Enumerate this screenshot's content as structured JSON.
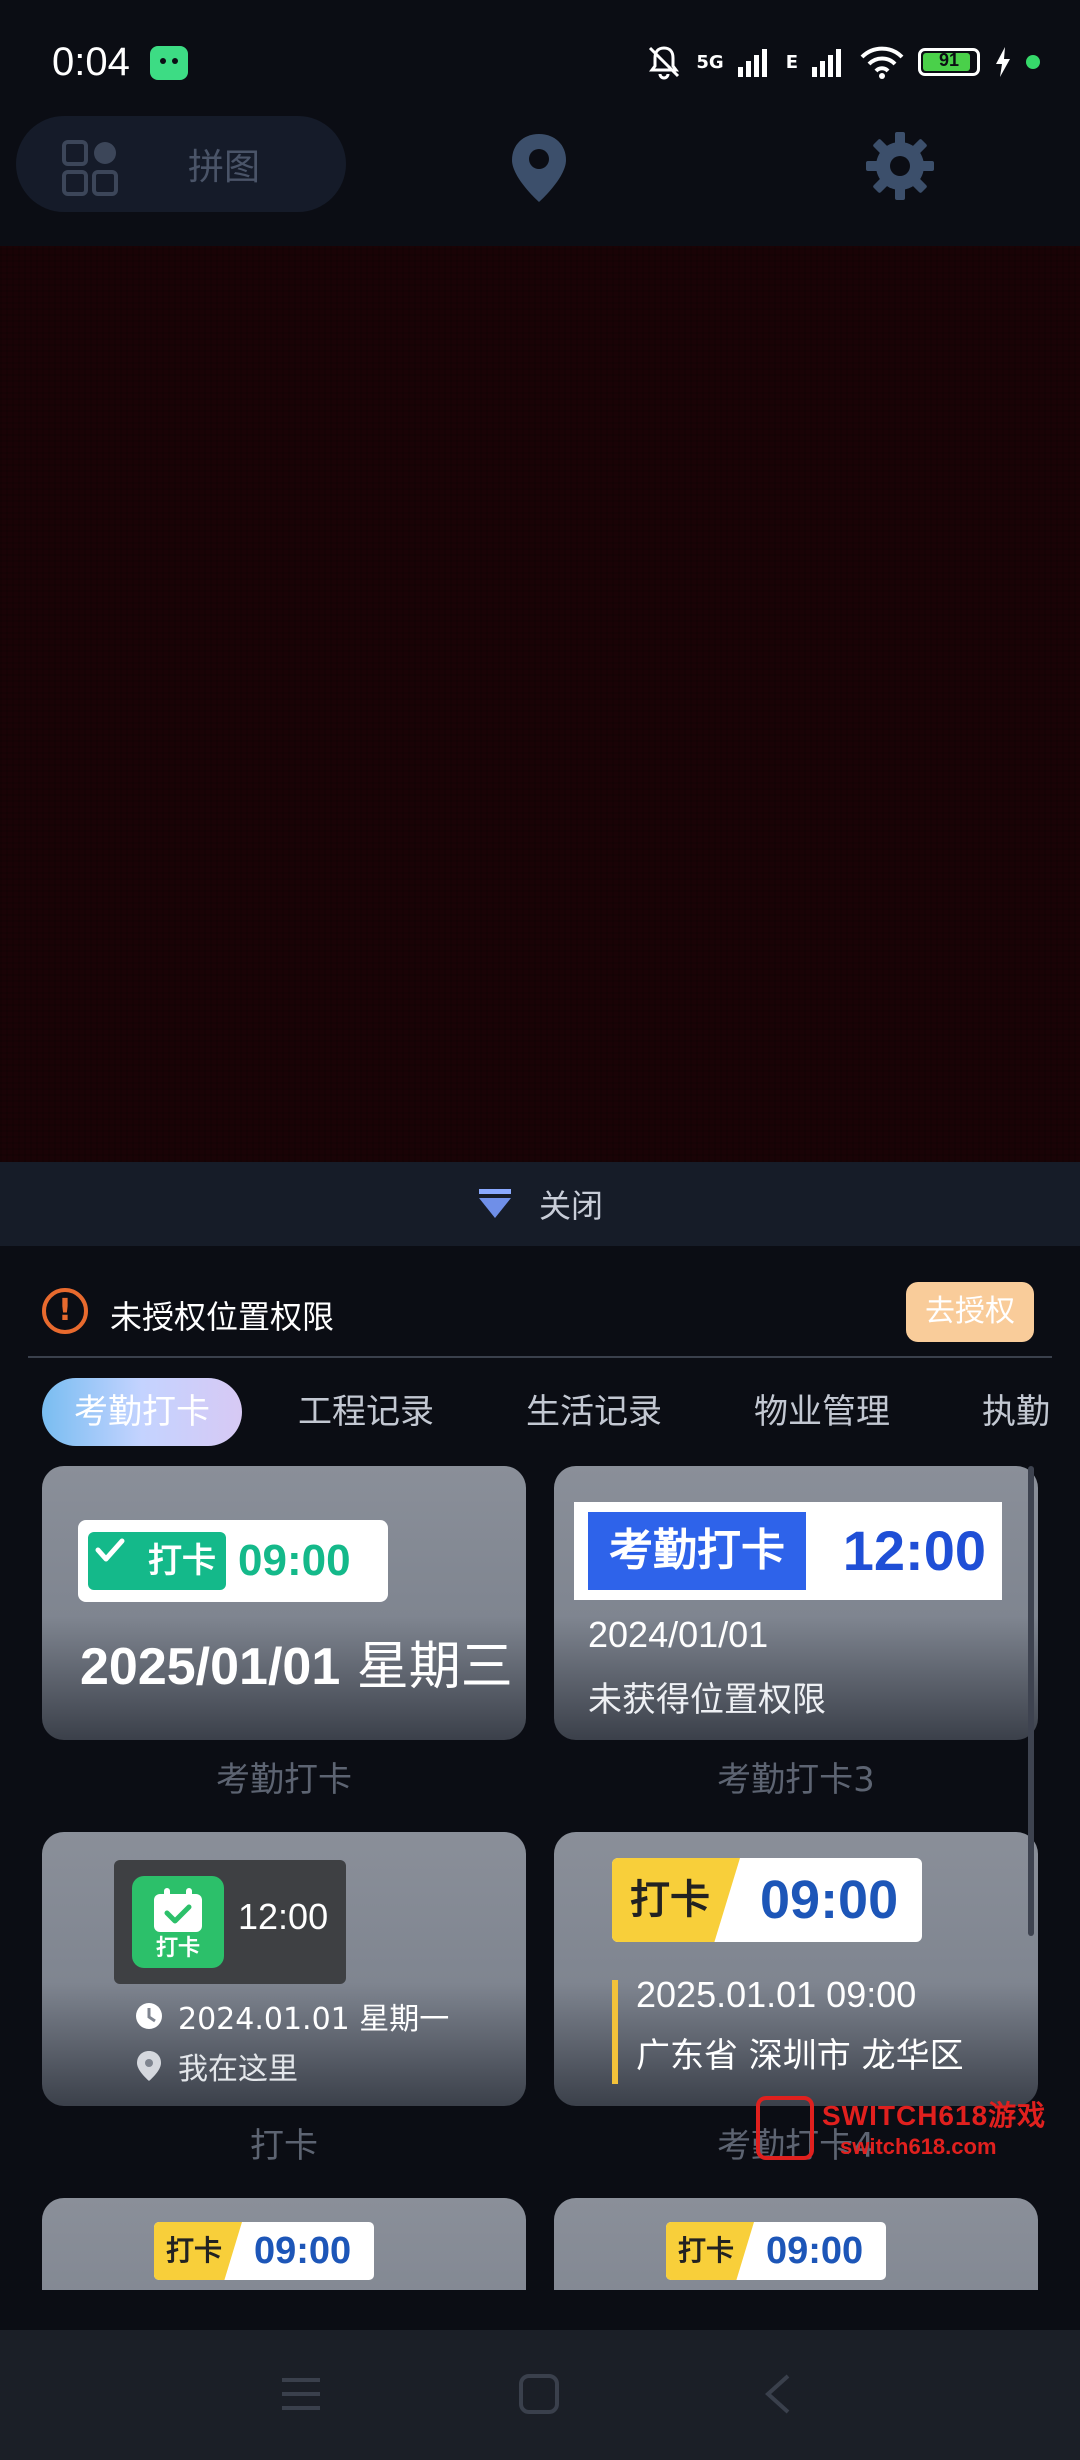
{
  "status_bar": {
    "time": "0:04",
    "network": "5G",
    "network2": "E",
    "battery": "91",
    "battery_level": 0.91,
    "icons": [
      "android-icon",
      "mute-icon",
      "signal-icon",
      "wifi-icon",
      "battery-icon",
      "charging-icon"
    ]
  },
  "top_nav": {
    "pintu_label": "拼图",
    "icons": [
      "grid-icon",
      "location-pin-icon",
      "gear-icon"
    ]
  },
  "close_bar": {
    "label": "关闭"
  },
  "permission": {
    "text": "未授权位置权限",
    "button": "去授权"
  },
  "tabs": [
    {
      "label": "考勤打卡",
      "active": true
    },
    {
      "label": "工程记录",
      "active": false
    },
    {
      "label": "生活记录",
      "active": false
    },
    {
      "label": "物业管理",
      "active": false
    },
    {
      "label": "执勤",
      "active": false
    }
  ],
  "templates": [
    {
      "caption": "考勤打卡",
      "badge": "打卡",
      "time": "09:00",
      "date": "2025/01/01",
      "weekday": "星期三"
    },
    {
      "caption": "考勤打卡3",
      "badge": "考勤打卡",
      "time": "12:00",
      "date": "2024/01/01",
      "location": "未获得位置权限"
    },
    {
      "caption": "打卡",
      "badge": "打卡",
      "time": "12:00",
      "date": "2024.01.01 星期一",
      "location": "我在这里"
    },
    {
      "caption": "考勤打卡4",
      "badge": "打卡",
      "time": "09:00",
      "datetime": "2025.01.01 09:00",
      "address": "广东省 深圳市 龙华区"
    },
    {
      "badge": "打卡",
      "time": "09:00"
    },
    {
      "badge": "打卡",
      "time": "09:00"
    }
  ],
  "watermark": {
    "line1": "SWITCH618游戏",
    "line2": "switch618.com"
  },
  "colors": {
    "accent_green": "#14b98a",
    "accent_blue": "#2e63ea",
    "accent_yellow": "#f8cf3a",
    "warning_orange": "#e86a2e",
    "permission_button": "#f9cc9a"
  }
}
